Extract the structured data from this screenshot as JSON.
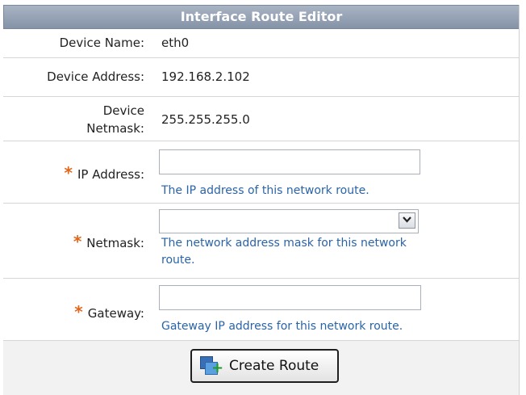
{
  "title": "Interface Route Editor",
  "device": {
    "name_label": "Device Name:",
    "name_value": "eth0",
    "address_label": "Device Address:",
    "address_value": "192.168.2.102",
    "netmask_label_1": "Device",
    "netmask_label_2": "Netmask:",
    "netmask_value": "255.255.255.0"
  },
  "form": {
    "required_mark": "*",
    "ip": {
      "label": "IP Address:",
      "value": "",
      "help": "The IP address of this network route."
    },
    "netmask": {
      "label": "Netmask:",
      "value": "",
      "help_line1": "The network address mask for this network",
      "help_line2": "route."
    },
    "gateway": {
      "label": "Gateway:",
      "value": "",
      "help": "Gateway IP address for this network route."
    }
  },
  "actions": {
    "create_label": "Create Route"
  },
  "icons": {
    "dropdown": "chevron-down-icon",
    "create": "create-route-icon"
  },
  "colors": {
    "header": "#8593a8",
    "required": "#e2661a",
    "help_text": "#2a64a8"
  }
}
